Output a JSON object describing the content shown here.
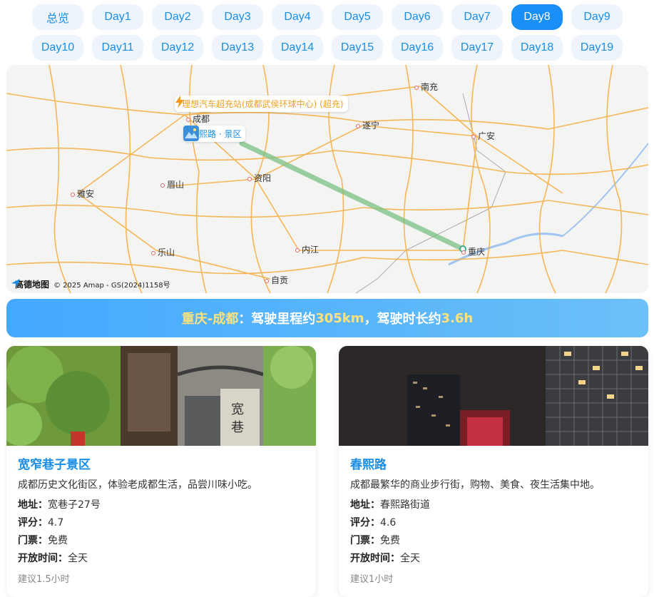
{
  "tabs": [
    "总览",
    "Day1",
    "Day2",
    "Day3",
    "Day4",
    "Day5",
    "Day6",
    "Day7",
    "Day8",
    "Day9",
    "Day10",
    "Day11",
    "Day12",
    "Day13",
    "Day14",
    "Day15",
    "Day16",
    "Day17",
    "Day18",
    "Day19"
  ],
  "active_tab": "Day8",
  "map": {
    "poi_charge": "理想汽车超充站(成都武侯环球中心) (超充)",
    "poi_spot": "春熙路 · 景区",
    "cities": {
      "nanchong": "南充",
      "chengdu": "成都",
      "suining": "遂宁",
      "guangan": "广安",
      "meishan": "眉山",
      "ziyang": "资阳",
      "yaan": "雅安",
      "leshan": "乐山",
      "neijiang": "内江",
      "chongqing": "重庆",
      "zigong": "自贡"
    },
    "logo": "高德地图",
    "copyright": "© 2025 Amap - GS(2024)1158号"
  },
  "summary": {
    "route": "重庆-成都",
    "sep1": "：驾驶里程约",
    "distance": "305km",
    "sep2": "，驾驶时长约",
    "duration": "3.6h"
  },
  "cards": [
    {
      "title": "宽窄巷子景区",
      "desc": "成都历史文化街区，体验老成都生活，品尝川味小吃。",
      "address_label": "地址：",
      "address": "宽巷子27号",
      "rating_label": "评分：",
      "rating": "4.7",
      "ticket_label": "门票：",
      "ticket": "免费",
      "hours_label": "开放时间：",
      "hours": "全天",
      "hint": "建议1.5小时"
    },
    {
      "title": "春熙路",
      "desc": "成都最繁华的商业步行街，购物、美食、夜生活集中地。",
      "address_label": "地址：",
      "address": "春熙路街道",
      "rating_label": "评分：",
      "rating": "4.6",
      "ticket_label": "门票：",
      "ticket": "免费",
      "hours_label": "开放时间：",
      "hours": "全天",
      "hint": "建议1小时"
    }
  ]
}
